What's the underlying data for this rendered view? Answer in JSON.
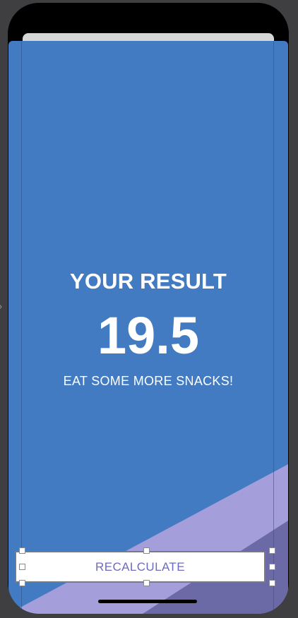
{
  "results": {
    "title": "YOUR RESULT",
    "value": "19.5",
    "advice": "EAT SOME MORE SNACKS!"
  },
  "button": {
    "label": "RECALCULATE"
  },
  "colors": {
    "background": "#427bc1",
    "stripe_light": "#a49fdb",
    "stripe_dark": "#6b6aa6",
    "button_text": "#6c6bbf",
    "canvas": "#3f3f41"
  },
  "icons": {
    "side_arrow": "chevron-right-icon"
  }
}
